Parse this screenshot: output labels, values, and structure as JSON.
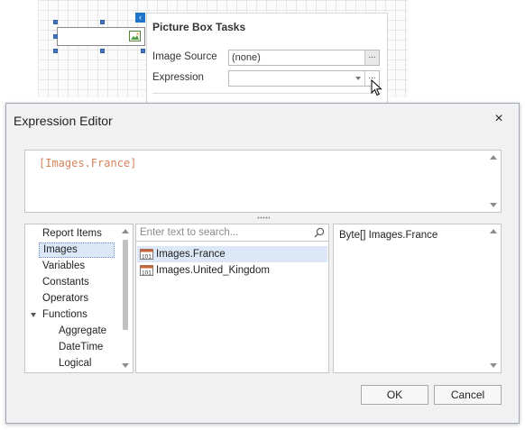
{
  "tasks_panel": {
    "title": "Picture Box Tasks",
    "image_source_label": "Image Source",
    "image_source_value": "(none)",
    "expression_label": "Expression",
    "expression_value": "",
    "browse_button_label": "...",
    "expression_button_label": "..."
  },
  "dialog": {
    "title": "Expression Editor",
    "close_label": "×",
    "expression_text": "[Images.France]",
    "categories": [
      "Report Items",
      "Images",
      "Variables",
      "Constants",
      "Operators",
      "Functions",
      "Aggregate",
      "DateTime",
      "Logical"
    ],
    "selected_category": "Images",
    "search_placeholder": "Enter text to search...",
    "items": [
      "Images.France",
      "Images.United_Kingdom"
    ],
    "selected_item": "Images.France",
    "description": "Byte[] Images.France",
    "ok_label": "OK",
    "cancel_label": "Cancel"
  },
  "colors": {
    "selection": "#dce8f7",
    "expression_text": "#d4835b",
    "handle": "#4472c4",
    "smart_tag": "#1f73c8"
  }
}
